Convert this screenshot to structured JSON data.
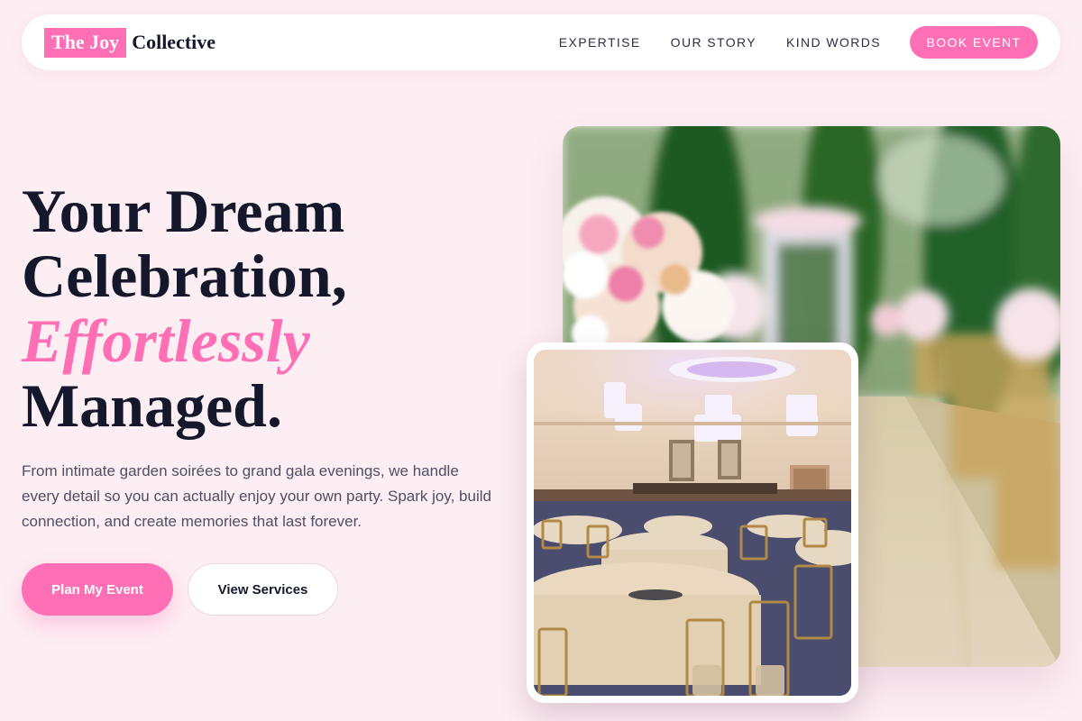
{
  "brand": {
    "mark": "The Joy",
    "rest": "Collective",
    "accent_color": "#ff6fb5"
  },
  "nav": {
    "links": [
      "EXPERTISE",
      "OUR STORY",
      "KIND WORDS"
    ],
    "cta": "BOOK EVENT"
  },
  "hero": {
    "title_line1": "Your Dream",
    "title_line2": "Celebration,",
    "title_accent": "Effortlessly",
    "title_line4": "Managed.",
    "subtitle": "From intimate garden soirées to grand gala evenings, we handle every detail so you can actually enjoy your own party. Spark joy, build connection, and create memories that last forever.",
    "primary_button": "Plan My Event",
    "secondary_button": "View Services"
  },
  "images": {
    "garden": "outdoor-wedding-aisle-photo",
    "ballroom": "banquet-hall-photo"
  }
}
